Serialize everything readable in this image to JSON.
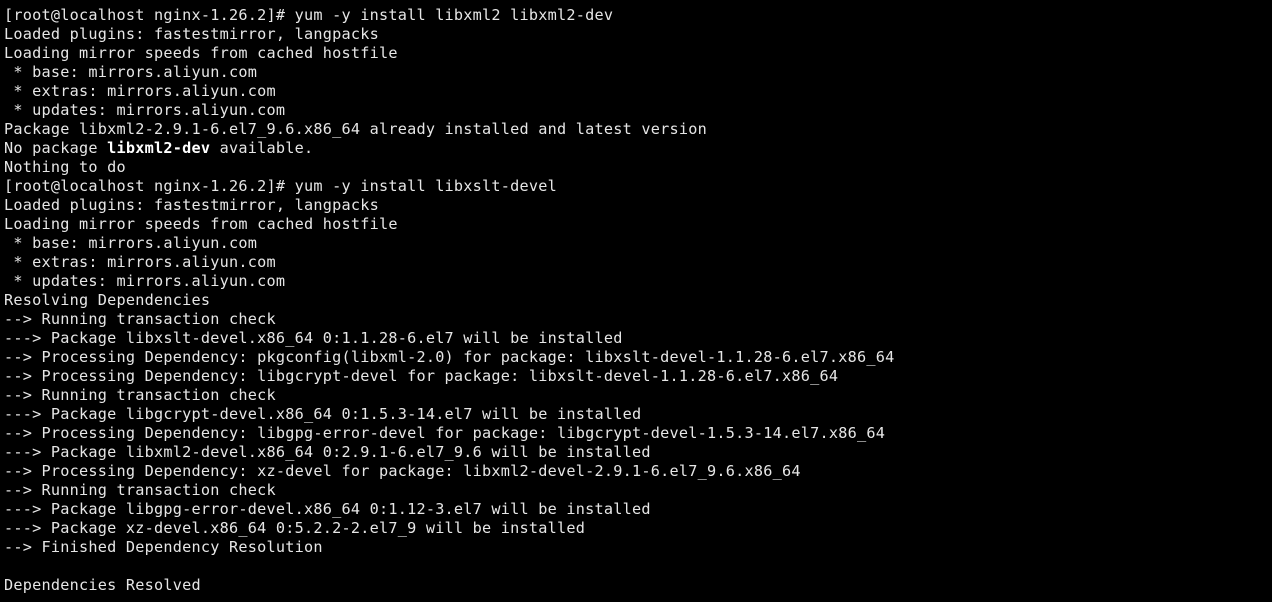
{
  "terminal": {
    "type": "console-output",
    "prompt": "[root@localhost nginx-1.26.2]#",
    "hostname": "localhost",
    "user": "root",
    "cwd": "nginx-1.26.2",
    "colors": {
      "background": "#000000",
      "foreground": "#e6e6e6",
      "bold_foreground": "#ffffff"
    },
    "lines": [
      {
        "text": "[root@localhost nginx-1.26.2]# yum -y install libxml2 libxml2-dev"
      },
      {
        "text": "Loaded plugins: fastestmirror, langpacks"
      },
      {
        "text": "Loading mirror speeds from cached hostfile"
      },
      {
        "text": " * base: mirrors.aliyun.com"
      },
      {
        "text": " * extras: mirrors.aliyun.com"
      },
      {
        "text": " * updates: mirrors.aliyun.com"
      },
      {
        "text": "Package libxml2-2.9.1-6.el7_9.6.x86_64 already installed and latest version"
      },
      {
        "text": "No package ",
        "bold": "libxml2-dev",
        "after": " available."
      },
      {
        "text": "Nothing to do"
      },
      {
        "text": "[root@localhost nginx-1.26.2]# yum -y install libxslt-devel"
      },
      {
        "text": "Loaded plugins: fastestmirror, langpacks"
      },
      {
        "text": "Loading mirror speeds from cached hostfile"
      },
      {
        "text": " * base: mirrors.aliyun.com"
      },
      {
        "text": " * extras: mirrors.aliyun.com"
      },
      {
        "text": " * updates: mirrors.aliyun.com"
      },
      {
        "text": "Resolving Dependencies"
      },
      {
        "text": "--> Running transaction check"
      },
      {
        "text": "---> Package libxslt-devel.x86_64 0:1.1.28-6.el7 will be installed"
      },
      {
        "text": "--> Processing Dependency: pkgconfig(libxml-2.0) for package: libxslt-devel-1.1.28-6.el7.x86_64"
      },
      {
        "text": "--> Processing Dependency: libgcrypt-devel for package: libxslt-devel-1.1.28-6.el7.x86_64"
      },
      {
        "text": "--> Running transaction check"
      },
      {
        "text": "---> Package libgcrypt-devel.x86_64 0:1.5.3-14.el7 will be installed"
      },
      {
        "text": "--> Processing Dependency: libgpg-error-devel for package: libgcrypt-devel-1.5.3-14.el7.x86_64"
      },
      {
        "text": "---> Package libxml2-devel.x86_64 0:2.9.1-6.el7_9.6 will be installed"
      },
      {
        "text": "--> Processing Dependency: xz-devel for package: libxml2-devel-2.9.1-6.el7_9.6.x86_64"
      },
      {
        "text": "--> Running transaction check"
      },
      {
        "text": "---> Package libgpg-error-devel.x86_64 0:1.12-3.el7 will be installed"
      },
      {
        "text": "---> Package xz-devel.x86_64 0:5.2.2-2.el7_9 will be installed"
      },
      {
        "text": "--> Finished Dependency Resolution"
      },
      {
        "text": ""
      },
      {
        "text": "Dependencies Resolved"
      }
    ]
  }
}
